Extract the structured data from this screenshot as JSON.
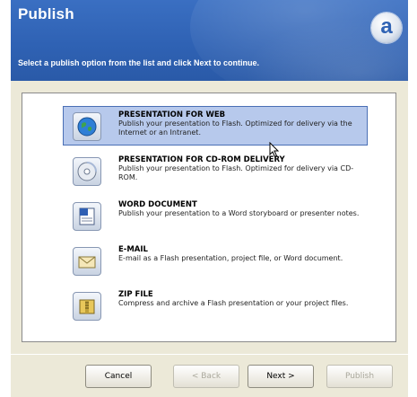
{
  "header": {
    "title": "Publish",
    "subtitle": "Select a publish option from the list and click Next to continue.",
    "logo_letter": "a",
    "logo_icon": "captivate-logo-icon"
  },
  "options": [
    {
      "title": "PRESENTATION FOR WEB",
      "description": "Publish your presentation to Flash. Optimized for delivery via the Internet or an Intranet.",
      "icon": "globe-icon",
      "selected": true
    },
    {
      "title": "PRESENTATION FOR CD-ROM DELIVERY",
      "description": "Publish your presentation to Flash. Optimized for delivery via CD-ROM.",
      "icon": "cd-icon",
      "selected": false
    },
    {
      "title": "WORD DOCUMENT",
      "description": "Publish your presentation to a Word storyboard or presenter notes.",
      "icon": "word-document-icon",
      "selected": false
    },
    {
      "title": "E-MAIL",
      "description": "E-mail as a Flash presentation, project file, or Word document.",
      "icon": "envelope-icon",
      "selected": false
    },
    {
      "title": "ZIP FILE",
      "description": "Compress and archive a Flash presentation or your project files.",
      "icon": "zip-file-icon",
      "selected": false
    }
  ],
  "buttons": {
    "cancel": "Cancel",
    "back": "< Back",
    "next": "Next >",
    "publish": "Publish"
  },
  "colors": {
    "header_blue": "#2f62b4",
    "selection": "#b7c9ec",
    "window_bg": "#ece9d8"
  }
}
